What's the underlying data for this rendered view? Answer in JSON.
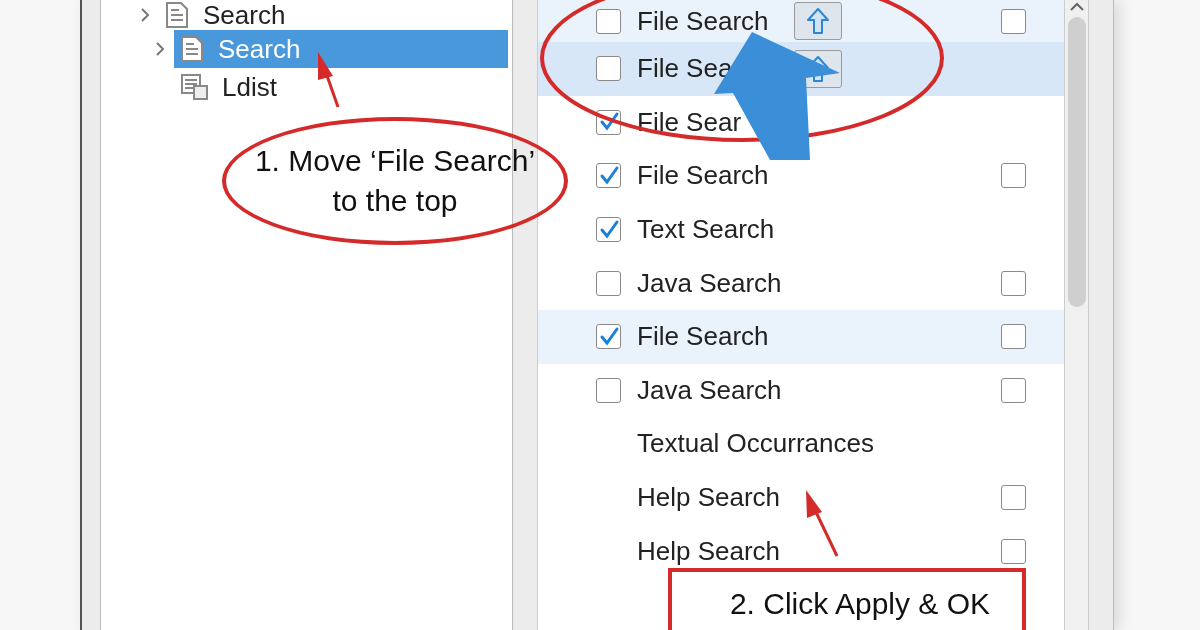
{
  "tree": {
    "items": [
      {
        "label": "Search",
        "expandable": true,
        "selected": false,
        "children": [
          {
            "label": "Search",
            "expandable": true,
            "selected": true
          },
          {
            "label": "Ldist",
            "expandable": false,
            "selected": false
          }
        ]
      }
    ]
  },
  "list": {
    "items": [
      {
        "kind": "checkbox",
        "checked": false,
        "label": "File Search",
        "up_button": true,
        "option": {
          "checked": false
        },
        "selected": false,
        "highlighted": true
      },
      {
        "kind": "checkbox",
        "checked": false,
        "label": "File Sea",
        "up_button": true,
        "selected": true,
        "highlighted": false
      },
      {
        "kind": "checkbox",
        "checked": true,
        "label": "File Sear",
        "up_button": false,
        "selected": false,
        "highlighted": false
      },
      {
        "kind": "checkbox",
        "checked": true,
        "label": "File Search",
        "up_button": false,
        "option": {
          "checked": false
        },
        "selected": false,
        "highlighted": false
      },
      {
        "kind": "checkbox",
        "checked": true,
        "label": "Text Search",
        "up_button": false,
        "selected": false,
        "highlighted": false
      },
      {
        "kind": "checkbox",
        "checked": false,
        "label": "Java Search",
        "up_button": false,
        "option": {
          "checked": false
        },
        "selected": false,
        "highlighted": false
      },
      {
        "kind": "checkbox",
        "checked": true,
        "label": "File Search",
        "up_button": false,
        "option": {
          "checked": false
        },
        "selected": false,
        "highlighted": true
      },
      {
        "kind": "checkbox",
        "checked": false,
        "label": "Java Search",
        "up_button": false,
        "option": {
          "checked": false
        },
        "selected": false,
        "highlighted": false
      },
      {
        "kind": "plain",
        "label": "Textual Occurrances",
        "up_button": false,
        "selected": false,
        "highlighted": false
      },
      {
        "kind": "plain",
        "label": "Help Search",
        "up_button": false,
        "option": {
          "checked": false
        },
        "selected": false,
        "highlighted": false
      },
      {
        "kind": "plain",
        "label": "Help Search",
        "up_button": false,
        "option": {
          "checked": false
        },
        "selected": false,
        "highlighted": false
      }
    ]
  },
  "callouts": [
    {
      "kind": "ellipse",
      "text": "1. Move ‘File Search’\nto the top"
    },
    {
      "kind": "box",
      "text": "2. Click Apply & OK"
    }
  ]
}
